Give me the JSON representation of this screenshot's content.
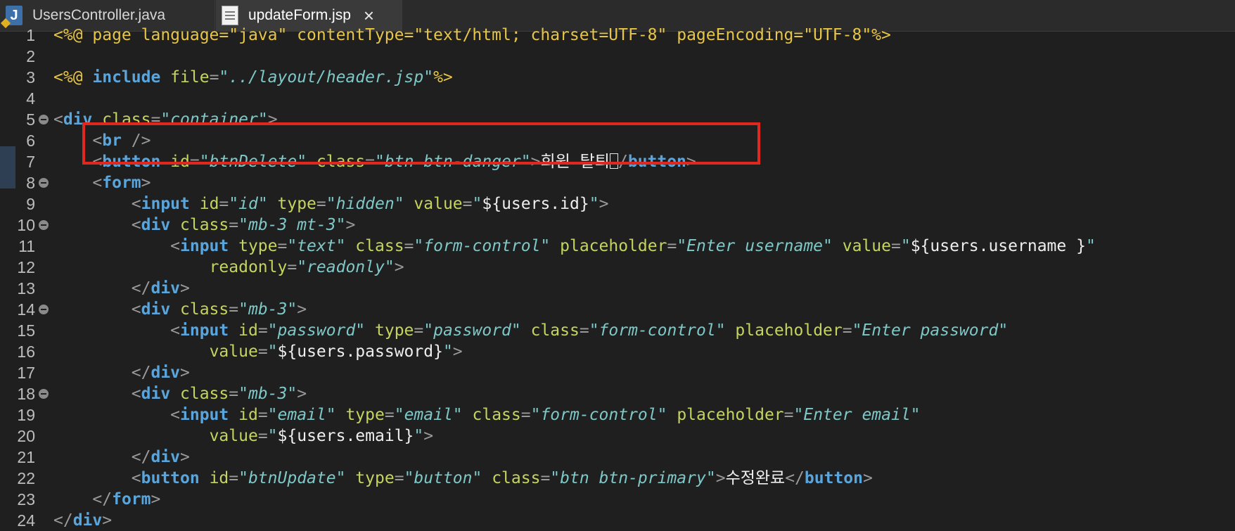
{
  "tabs": [
    {
      "label": "UsersController.java",
      "icon": "java-file-icon",
      "active": false
    },
    {
      "label": "updateForm.jsp",
      "icon": "jsp-file-icon",
      "active": true,
      "close": "close-icon"
    }
  ],
  "editor": {
    "lines": [
      {
        "num": "1",
        "fold": false,
        "tokens": [
          {
            "t": "<%@ page language=\"java\" contentType=\"text/html; charset=UTF-8\" pageEncoding=\"UTF-8\"%>",
            "c": "t-dir"
          }
        ]
      },
      {
        "num": "2",
        "fold": false,
        "tokens": []
      },
      {
        "num": "3",
        "fold": false,
        "tokens": [
          {
            "t": "<%@ ",
            "c": "t-dir"
          },
          {
            "t": "include ",
            "c": "t-tag"
          },
          {
            "t": "file",
            "c": "t-attr"
          },
          {
            "t": "=",
            "c": "t-punc"
          },
          {
            "t": "\"../layout/header.jsp\"",
            "c": "t-val"
          },
          {
            "t": "%>",
            "c": "t-dir"
          }
        ]
      },
      {
        "num": "4",
        "fold": false,
        "tokens": []
      },
      {
        "num": "5",
        "fold": true,
        "tokens": [
          {
            "t": "<",
            "c": "t-punc"
          },
          {
            "t": "div ",
            "c": "t-tag"
          },
          {
            "t": "class",
            "c": "t-attr"
          },
          {
            "t": "=",
            "c": "t-punc"
          },
          {
            "t": "\"container\"",
            "c": "t-val"
          },
          {
            "t": ">",
            "c": "t-punc"
          }
        ]
      },
      {
        "num": "6",
        "fold": false,
        "tokens": [
          {
            "t": "    <",
            "c": "t-punc"
          },
          {
            "t": "br ",
            "c": "t-tag"
          },
          {
            "t": "/>",
            "c": "t-punc"
          }
        ]
      },
      {
        "num": "7",
        "fold": false,
        "cursor": true,
        "tokens": [
          {
            "t": "    <",
            "c": "t-punc"
          },
          {
            "t": "button ",
            "c": "t-tag"
          },
          {
            "t": "id",
            "c": "t-attr"
          },
          {
            "t": "=",
            "c": "t-punc"
          },
          {
            "t": "\"btnDelete\"",
            "c": "t-val"
          },
          {
            "t": " class",
            "c": "t-attr"
          },
          {
            "t": "=",
            "c": "t-punc"
          },
          {
            "t": "\"btn btn-danger\"",
            "c": "t-val"
          },
          {
            "t": ">",
            "c": "t-punc"
          },
          {
            "t": "회원 탈퇴",
            "c": "t-text"
          },
          {
            "t": "CURSOR",
            "c": "cursor"
          },
          {
            "t": "/",
            "c": "t-punc"
          },
          {
            "t": "button",
            "c": "t-tag"
          },
          {
            "t": ">",
            "c": "t-punc"
          }
        ]
      },
      {
        "num": "8",
        "fold": true,
        "tokens": [
          {
            "t": "    <",
            "c": "t-punc"
          },
          {
            "t": "form",
            "c": "t-tag"
          },
          {
            "t": ">",
            "c": "t-punc"
          }
        ]
      },
      {
        "num": "9",
        "fold": false,
        "tokens": [
          {
            "t": "        <",
            "c": "t-punc"
          },
          {
            "t": "input ",
            "c": "t-tag"
          },
          {
            "t": "id",
            "c": "t-attr"
          },
          {
            "t": "=",
            "c": "t-punc"
          },
          {
            "t": "\"id\"",
            "c": "t-val"
          },
          {
            "t": " type",
            "c": "t-attr"
          },
          {
            "t": "=",
            "c": "t-punc"
          },
          {
            "t": "\"hidden\"",
            "c": "t-val"
          },
          {
            "t": " value",
            "c": "t-attr"
          },
          {
            "t": "=",
            "c": "t-punc"
          },
          {
            "t": "\"",
            "c": "t-val"
          },
          {
            "t": "${users.id}",
            "c": "t-text"
          },
          {
            "t": "\"",
            "c": "t-val"
          },
          {
            "t": ">",
            "c": "t-punc"
          }
        ]
      },
      {
        "num": "10",
        "fold": true,
        "tokens": [
          {
            "t": "        <",
            "c": "t-punc"
          },
          {
            "t": "div ",
            "c": "t-tag"
          },
          {
            "t": "class",
            "c": "t-attr"
          },
          {
            "t": "=",
            "c": "t-punc"
          },
          {
            "t": "\"mb-3 mt-3\"",
            "c": "t-val"
          },
          {
            "t": ">",
            "c": "t-punc"
          }
        ]
      },
      {
        "num": "11",
        "fold": false,
        "tokens": [
          {
            "t": "            <",
            "c": "t-punc"
          },
          {
            "t": "input ",
            "c": "t-tag"
          },
          {
            "t": "type",
            "c": "t-attr"
          },
          {
            "t": "=",
            "c": "t-punc"
          },
          {
            "t": "\"text\"",
            "c": "t-val"
          },
          {
            "t": " class",
            "c": "t-attr"
          },
          {
            "t": "=",
            "c": "t-punc"
          },
          {
            "t": "\"form-control\"",
            "c": "t-val"
          },
          {
            "t": " placeholder",
            "c": "t-attr"
          },
          {
            "t": "=",
            "c": "t-punc"
          },
          {
            "t": "\"Enter username\"",
            "c": "t-val"
          },
          {
            "t": " value",
            "c": "t-attr"
          },
          {
            "t": "=",
            "c": "t-punc"
          },
          {
            "t": "\"",
            "c": "t-val"
          },
          {
            "t": "${users.username }",
            "c": "t-text"
          },
          {
            "t": "\"",
            "c": "t-val"
          }
        ]
      },
      {
        "num": "12",
        "fold": false,
        "tokens": [
          {
            "t": "                ",
            "c": "t-text"
          },
          {
            "t": "readonly",
            "c": "t-attr"
          },
          {
            "t": "=",
            "c": "t-punc"
          },
          {
            "t": "\"readonly\"",
            "c": "t-val"
          },
          {
            "t": ">",
            "c": "t-punc"
          }
        ]
      },
      {
        "num": "13",
        "fold": false,
        "tokens": [
          {
            "t": "        </",
            "c": "t-punc"
          },
          {
            "t": "div",
            "c": "t-tag"
          },
          {
            "t": ">",
            "c": "t-punc"
          }
        ]
      },
      {
        "num": "14",
        "fold": true,
        "tokens": [
          {
            "t": "        <",
            "c": "t-punc"
          },
          {
            "t": "div ",
            "c": "t-tag"
          },
          {
            "t": "class",
            "c": "t-attr"
          },
          {
            "t": "=",
            "c": "t-punc"
          },
          {
            "t": "\"mb-3\"",
            "c": "t-val"
          },
          {
            "t": ">",
            "c": "t-punc"
          }
        ]
      },
      {
        "num": "15",
        "fold": false,
        "tokens": [
          {
            "t": "            <",
            "c": "t-punc"
          },
          {
            "t": "input ",
            "c": "t-tag"
          },
          {
            "t": "id",
            "c": "t-attr"
          },
          {
            "t": "=",
            "c": "t-punc"
          },
          {
            "t": "\"password\"",
            "c": "t-val"
          },
          {
            "t": " type",
            "c": "t-attr"
          },
          {
            "t": "=",
            "c": "t-punc"
          },
          {
            "t": "\"password\"",
            "c": "t-val"
          },
          {
            "t": " class",
            "c": "t-attr"
          },
          {
            "t": "=",
            "c": "t-punc"
          },
          {
            "t": "\"form-control\"",
            "c": "t-val"
          },
          {
            "t": " placeholder",
            "c": "t-attr"
          },
          {
            "t": "=",
            "c": "t-punc"
          },
          {
            "t": "\"Enter password\"",
            "c": "t-val"
          }
        ]
      },
      {
        "num": "16",
        "fold": false,
        "tokens": [
          {
            "t": "                ",
            "c": "t-text"
          },
          {
            "t": "value",
            "c": "t-attr"
          },
          {
            "t": "=",
            "c": "t-punc"
          },
          {
            "t": "\"",
            "c": "t-val"
          },
          {
            "t": "${users.password}",
            "c": "t-text"
          },
          {
            "t": "\"",
            "c": "t-val"
          },
          {
            "t": ">",
            "c": "t-punc"
          }
        ]
      },
      {
        "num": "17",
        "fold": false,
        "tokens": [
          {
            "t": "        </",
            "c": "t-punc"
          },
          {
            "t": "div",
            "c": "t-tag"
          },
          {
            "t": ">",
            "c": "t-punc"
          }
        ]
      },
      {
        "num": "18",
        "fold": true,
        "tokens": [
          {
            "t": "        <",
            "c": "t-punc"
          },
          {
            "t": "div ",
            "c": "t-tag"
          },
          {
            "t": "class",
            "c": "t-attr"
          },
          {
            "t": "=",
            "c": "t-punc"
          },
          {
            "t": "\"mb-3\"",
            "c": "t-val"
          },
          {
            "t": ">",
            "c": "t-punc"
          }
        ]
      },
      {
        "num": "19",
        "fold": false,
        "tokens": [
          {
            "t": "            <",
            "c": "t-punc"
          },
          {
            "t": "input ",
            "c": "t-tag"
          },
          {
            "t": "id",
            "c": "t-attr"
          },
          {
            "t": "=",
            "c": "t-punc"
          },
          {
            "t": "\"email\"",
            "c": "t-val"
          },
          {
            "t": " type",
            "c": "t-attr"
          },
          {
            "t": "=",
            "c": "t-punc"
          },
          {
            "t": "\"email\"",
            "c": "t-val"
          },
          {
            "t": " class",
            "c": "t-attr"
          },
          {
            "t": "=",
            "c": "t-punc"
          },
          {
            "t": "\"form-control\"",
            "c": "t-val"
          },
          {
            "t": " placeholder",
            "c": "t-attr"
          },
          {
            "t": "=",
            "c": "t-punc"
          },
          {
            "t": "\"Enter email\"",
            "c": "t-val"
          }
        ]
      },
      {
        "num": "20",
        "fold": false,
        "tokens": [
          {
            "t": "                ",
            "c": "t-text"
          },
          {
            "t": "value",
            "c": "t-attr"
          },
          {
            "t": "=",
            "c": "t-punc"
          },
          {
            "t": "\"",
            "c": "t-val"
          },
          {
            "t": "${users.email}",
            "c": "t-text"
          },
          {
            "t": "\"",
            "c": "t-val"
          },
          {
            "t": ">",
            "c": "t-punc"
          }
        ]
      },
      {
        "num": "21",
        "fold": false,
        "tokens": [
          {
            "t": "        </",
            "c": "t-punc"
          },
          {
            "t": "div",
            "c": "t-tag"
          },
          {
            "t": ">",
            "c": "t-punc"
          }
        ]
      },
      {
        "num": "22",
        "fold": false,
        "tokens": [
          {
            "t": "        <",
            "c": "t-punc"
          },
          {
            "t": "button ",
            "c": "t-tag"
          },
          {
            "t": "id",
            "c": "t-attr"
          },
          {
            "t": "=",
            "c": "t-punc"
          },
          {
            "t": "\"btnUpdate\"",
            "c": "t-val"
          },
          {
            "t": " type",
            "c": "t-attr"
          },
          {
            "t": "=",
            "c": "t-punc"
          },
          {
            "t": "\"button\"",
            "c": "t-val"
          },
          {
            "t": " class",
            "c": "t-attr"
          },
          {
            "t": "=",
            "c": "t-punc"
          },
          {
            "t": "\"btn btn-primary\"",
            "c": "t-val"
          },
          {
            "t": ">",
            "c": "t-punc"
          },
          {
            "t": "수정완료",
            "c": "t-text"
          },
          {
            "t": "</",
            "c": "t-punc"
          },
          {
            "t": "button",
            "c": "t-tag"
          },
          {
            "t": ">",
            "c": "t-punc"
          }
        ]
      },
      {
        "num": "23",
        "fold": false,
        "tokens": [
          {
            "t": "    </",
            "c": "t-punc"
          },
          {
            "t": "form",
            "c": "t-tag"
          },
          {
            "t": ">",
            "c": "t-punc"
          }
        ]
      },
      {
        "num": "24",
        "fold": false,
        "tokens": [
          {
            "t": "</",
            "c": "t-punc"
          },
          {
            "t": "div",
            "c": "t-tag"
          },
          {
            "t": ">",
            "c": "t-punc"
          }
        ]
      }
    ]
  },
  "colors": {
    "highlight_box": "#e1281f",
    "tag": "#5aa5dc",
    "attr": "#c5d45e",
    "value": "#7ec8c8"
  }
}
